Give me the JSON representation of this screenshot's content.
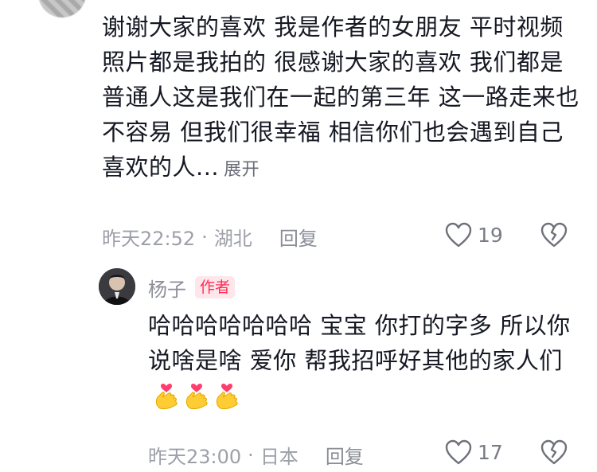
{
  "comment1": {
    "text": "谢谢大家的喜欢 我是作者的女朋友 平时视频照片都是我拍的 很感谢大家的喜欢 我们都是普通人这是我们在一起的第三年 这一路走来也不容易 但我们很幸福 相信你们也会遇到自己喜欢的人...",
    "expand_label": "展开",
    "time": "昨天22:52",
    "separator": "·",
    "location": "湖北",
    "reply_label": "回复",
    "like_count": "19"
  },
  "comment2": {
    "username": "杨子",
    "badge": "作者",
    "text": "哈哈哈哈哈哈哈 宝宝 你打的字多 所以你说啥是啥 爱你 帮我招呼好其他的家人们",
    "emoji": [
      "heart-hands-emoji",
      "heart-hands-emoji",
      "heart-hands-emoji"
    ],
    "time": "昨天23:00",
    "separator": "·",
    "location": "日本",
    "reply_label": "回复",
    "like_count": "17"
  },
  "colors": {
    "text": "#161823",
    "meta": "#9ea0a8",
    "badge_bg": "#ffe6ea",
    "badge_text": "#fe2c55",
    "emoji_heart": "#ff3d6e",
    "emoji_hand": "#ffcc33"
  }
}
